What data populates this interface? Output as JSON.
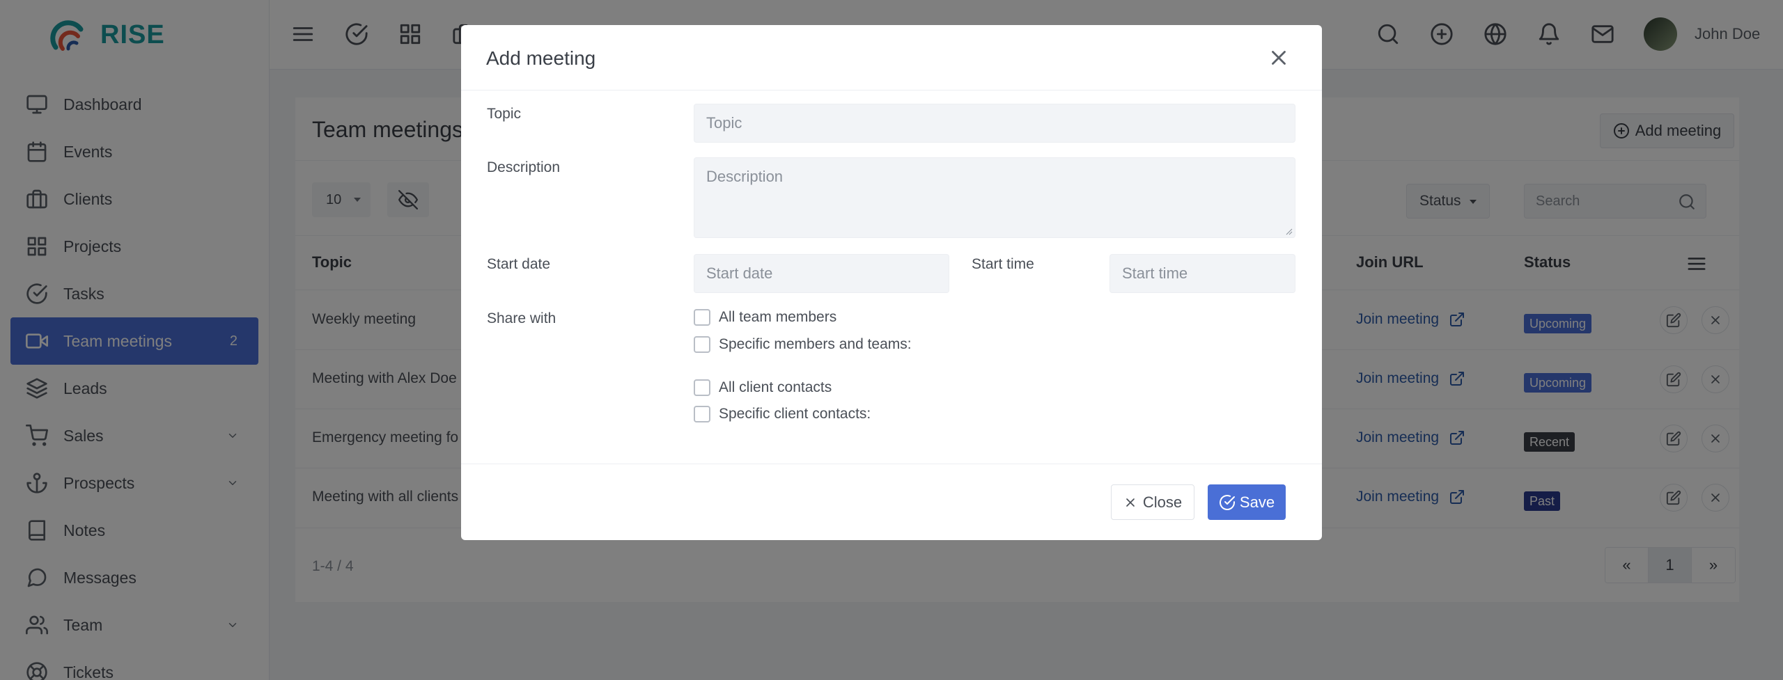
{
  "app": {
    "logo_text": "RISE"
  },
  "sidebar": {
    "items": [
      {
        "label": "Dashboard",
        "icon": "monitor-icon"
      },
      {
        "label": "Events",
        "icon": "calendar-icon"
      },
      {
        "label": "Clients",
        "icon": "briefcase-icon"
      },
      {
        "label": "Projects",
        "icon": "grid-icon"
      },
      {
        "label": "Tasks",
        "icon": "check-circle-icon"
      },
      {
        "label": "Team meetings",
        "icon": "video-icon",
        "badge": "2",
        "active": true
      },
      {
        "label": "Leads",
        "icon": "layers-icon"
      },
      {
        "label": "Sales",
        "icon": "cart-icon",
        "has_children": true
      },
      {
        "label": "Prospects",
        "icon": "anchor-icon",
        "has_children": true
      },
      {
        "label": "Notes",
        "icon": "book-icon"
      },
      {
        "label": "Messages",
        "icon": "message-icon"
      },
      {
        "label": "Team",
        "icon": "users-icon",
        "has_children": true
      },
      {
        "label": "Tickets",
        "icon": "lifebuoy-icon"
      }
    ]
  },
  "topbar": {
    "user_name": "John Doe"
  },
  "page": {
    "title": "Team meetings",
    "add_button": "Add meeting",
    "page_size": "10",
    "status_filter": "Status",
    "search_placeholder": "Search",
    "columns": {
      "topic": "Topic",
      "join_url": "Join URL",
      "status": "Status"
    },
    "rows": [
      {
        "topic": "Weekly meeting",
        "join": "Join meeting",
        "status": "Upcoming",
        "status_color": "#4a6fd6"
      },
      {
        "topic": "Meeting with Alex Doe",
        "join": "Join meeting",
        "status": "Upcoming",
        "status_color": "#4a6fd6"
      },
      {
        "topic": "Emergency meeting fo",
        "join": "Join meeting",
        "status": "Recent",
        "status_color": "#3a3f47"
      },
      {
        "topic": "Meeting with all clients",
        "join": "Join meeting",
        "status": "Past",
        "status_color": "#2b3a8f"
      }
    ],
    "pager_info": "1-4 / 4",
    "pager": {
      "prev": "«",
      "current": "1",
      "next": "»"
    }
  },
  "modal": {
    "title": "Add meeting",
    "topic_label": "Topic",
    "topic_placeholder": "Topic",
    "description_label": "Description",
    "description_placeholder": "Description",
    "start_date_label": "Start date",
    "start_date_placeholder": "Start date",
    "start_time_label": "Start time",
    "start_time_placeholder": "Start time",
    "share_label": "Share with",
    "share_options": [
      "All team members",
      "Specific members and teams:",
      "All client contacts",
      "Specific client contacts:"
    ],
    "close_button": "Close",
    "save_button": "Save"
  },
  "colors": {
    "accent": "#4a6fd6",
    "brand": "#1a9a9f",
    "link": "#2d5ba8"
  }
}
